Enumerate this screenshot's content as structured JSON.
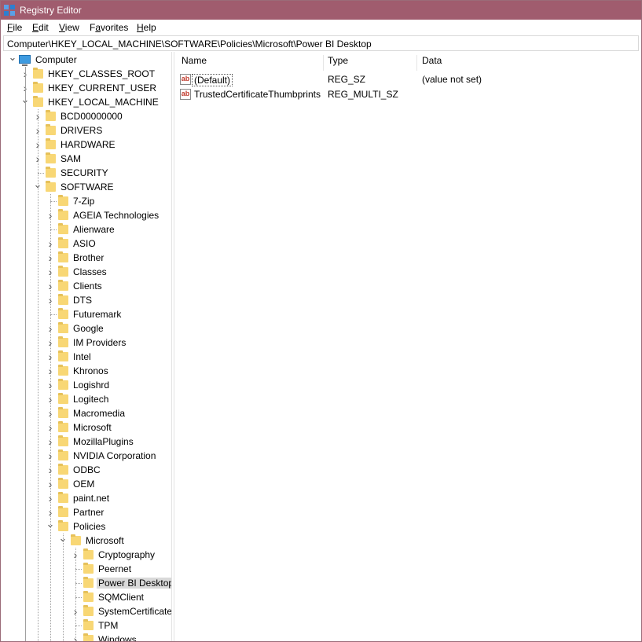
{
  "window": {
    "title": "Registry Editor"
  },
  "menu": [
    "File",
    "Edit",
    "View",
    "Favorites",
    "Help"
  ],
  "menu_accel": [
    "F",
    "E",
    "V",
    "a",
    "H"
  ],
  "address": {
    "path": "Computer\\HKEY_LOCAL_MACHINE\\SOFTWARE\\Policies\\Microsoft\\Power BI Desktop"
  },
  "tree": [
    {
      "label": "Computer",
      "level": 0,
      "expanded": true,
      "has_children": true,
      "icon": "computer-icon"
    },
    {
      "label": "HKEY_CLASSES_ROOT",
      "level": 1,
      "has_children": true
    },
    {
      "label": "HKEY_CURRENT_USER",
      "level": 1,
      "has_children": true
    },
    {
      "label": "HKEY_LOCAL_MACHINE",
      "level": 1,
      "expanded": true,
      "has_children": true
    },
    {
      "label": "BCD00000000",
      "level": 2,
      "has_children": true
    },
    {
      "label": "DRIVERS",
      "level": 2,
      "has_children": true
    },
    {
      "label": "HARDWARE",
      "level": 2,
      "has_children": true
    },
    {
      "label": "SAM",
      "level": 2,
      "has_children": true
    },
    {
      "label": "SECURITY",
      "level": 2,
      "has_children": false
    },
    {
      "label": "SOFTWARE",
      "level": 2,
      "expanded": true,
      "has_children": true
    },
    {
      "label": "7-Zip",
      "level": 3,
      "has_children": false
    },
    {
      "label": "AGEIA Technologies",
      "level": 3,
      "has_children": true
    },
    {
      "label": "Alienware",
      "level": 3,
      "has_children": false
    },
    {
      "label": "ASIO",
      "level": 3,
      "has_children": true
    },
    {
      "label": "Brother",
      "level": 3,
      "has_children": true
    },
    {
      "label": "Classes",
      "level": 3,
      "has_children": true
    },
    {
      "label": "Clients",
      "level": 3,
      "has_children": true
    },
    {
      "label": "DTS",
      "level": 3,
      "has_children": true
    },
    {
      "label": "Futuremark",
      "level": 3,
      "has_children": false
    },
    {
      "label": "Google",
      "level": 3,
      "has_children": true
    },
    {
      "label": "IM Providers",
      "level": 3,
      "has_children": true
    },
    {
      "label": "Intel",
      "level": 3,
      "has_children": true
    },
    {
      "label": "Khronos",
      "level": 3,
      "has_children": true
    },
    {
      "label": "Logishrd",
      "level": 3,
      "has_children": true
    },
    {
      "label": "Logitech",
      "level": 3,
      "has_children": true
    },
    {
      "label": "Macromedia",
      "level": 3,
      "has_children": true
    },
    {
      "label": "Microsoft",
      "level": 3,
      "has_children": true
    },
    {
      "label": "MozillaPlugins",
      "level": 3,
      "has_children": true
    },
    {
      "label": "NVIDIA Corporation",
      "level": 3,
      "has_children": true
    },
    {
      "label": "ODBC",
      "level": 3,
      "has_children": true
    },
    {
      "label": "OEM",
      "level": 3,
      "has_children": true
    },
    {
      "label": "paint.net",
      "level": 3,
      "has_children": true
    },
    {
      "label": "Partner",
      "level": 3,
      "has_children": true
    },
    {
      "label": "Policies",
      "level": 3,
      "expanded": true,
      "has_children": true
    },
    {
      "label": "Microsoft",
      "level": 4,
      "expanded": true,
      "has_children": true
    },
    {
      "label": "Cryptography",
      "level": 5,
      "has_children": true
    },
    {
      "label": "Peernet",
      "level": 5,
      "has_children": false
    },
    {
      "label": "Power BI Desktop",
      "level": 5,
      "has_children": false,
      "selected": true
    },
    {
      "label": "SQMClient",
      "level": 5,
      "has_children": false
    },
    {
      "label": "SystemCertificates",
      "level": 5,
      "has_children": true
    },
    {
      "label": "TPM",
      "level": 5,
      "has_children": false
    },
    {
      "label": "Windows",
      "level": 5,
      "has_children": true
    }
  ],
  "list": {
    "columns": [
      "Name",
      "Type",
      "Data"
    ],
    "rows": [
      {
        "name": "(Default)",
        "type": "REG_SZ",
        "data": "(value not set)",
        "icon": "string-value-icon",
        "focused": true
      },
      {
        "name": "TrustedCertificateThumbprints",
        "type": "REG_MULTI_SZ",
        "data": "",
        "icon": "string-value-icon"
      }
    ]
  },
  "colors": {
    "titlebar": "#a05c6e",
    "folder": "#f8d775",
    "selection": "#d9d9d9"
  }
}
